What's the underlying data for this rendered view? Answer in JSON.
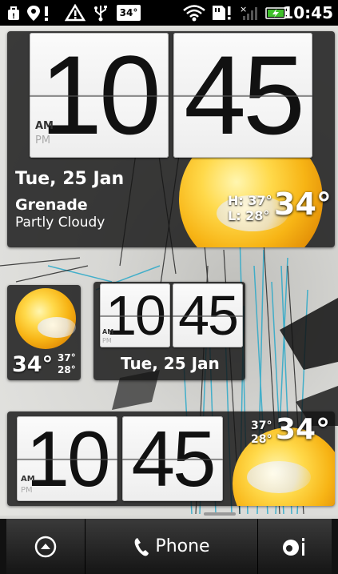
{
  "status_bar": {
    "icons": [
      "bag-icon",
      "location-alert-icon",
      "warning-icon",
      "usb-icon",
      "wifi-icon",
      "sd-alert-icon",
      "no-signal-icon",
      "battery-charging-icon"
    ],
    "temperature": "34°",
    "time": "10:45"
  },
  "widget_large": {
    "hour": "10",
    "minute": "45",
    "am": "AM",
    "pm": "PM",
    "date": "Tue, 25 Jan",
    "city": "Grenade",
    "condition": "Partly Cloudy",
    "high": "H: 37°",
    "low": "L: 28°",
    "current_temp": "34°"
  },
  "widget_weather_small": {
    "current_temp": "34°",
    "high": "37°",
    "low": "28°"
  },
  "widget_clock_medium": {
    "hour": "10",
    "minute": "45",
    "am": "AM",
    "pm": "PM",
    "date": "Tue, 25 Jan"
  },
  "widget_wide": {
    "hour": "10",
    "minute": "45",
    "am": "AM",
    "pm": "PM",
    "high": "37°",
    "low": "28°",
    "current_temp": "34°"
  },
  "dock": {
    "phone_label": "Phone"
  },
  "colors": {
    "accent_battery": "#3fbf2a",
    "sun": "#f7b415"
  }
}
